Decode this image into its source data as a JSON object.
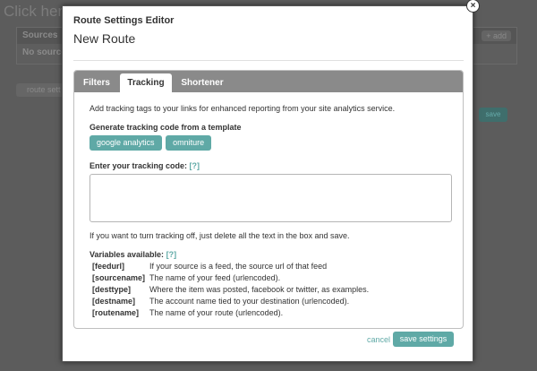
{
  "background": {
    "heading": "Click here",
    "sources_header": "Sources",
    "sources_body": "No source",
    "add_label": "+ add",
    "route_settings_label": "route sett",
    "save_label": "save"
  },
  "modal": {
    "header_title": "Route Settings Editor",
    "route_name": "New Route",
    "close_glyph": "×"
  },
  "tabs": [
    {
      "label": "Filters",
      "active": false
    },
    {
      "label": "Tracking",
      "active": true
    },
    {
      "label": "Shortener",
      "active": false
    }
  ],
  "tracking": {
    "intro": "Add tracking tags to your links for enhanced reporting from your site analytics service.",
    "generate_label": "Generate tracking code from a template",
    "templates": [
      "google analytics",
      "omniture"
    ],
    "code_label": "Enter your tracking code:",
    "help_link": "[?]",
    "code_value": "",
    "off_note": "If you want to turn tracking off, just delete all the text in the box and save.",
    "variables_label": "Variables available:",
    "variables_help": "[?]",
    "variables": [
      {
        "key": "[feedurl]",
        "desc": "If your source is a feed, the source url of that feed"
      },
      {
        "key": "[sourcename]",
        "desc": "The name of your feed (urlencoded)."
      },
      {
        "key": "[desttype]",
        "desc": "Where the item was posted, facebook or twitter, as examples."
      },
      {
        "key": "[destname]",
        "desc": "The account name tied to your destination (urlencoded)."
      },
      {
        "key": "[routename]",
        "desc": "The name of your route (urlencoded)."
      }
    ]
  },
  "footer": {
    "cancel_label": "cancel",
    "save_label": "save settings"
  },
  "colors": {
    "accent": "#5fa9a6",
    "tabbar": "#8a8a8a",
    "overlay": "#5c5c5c"
  }
}
